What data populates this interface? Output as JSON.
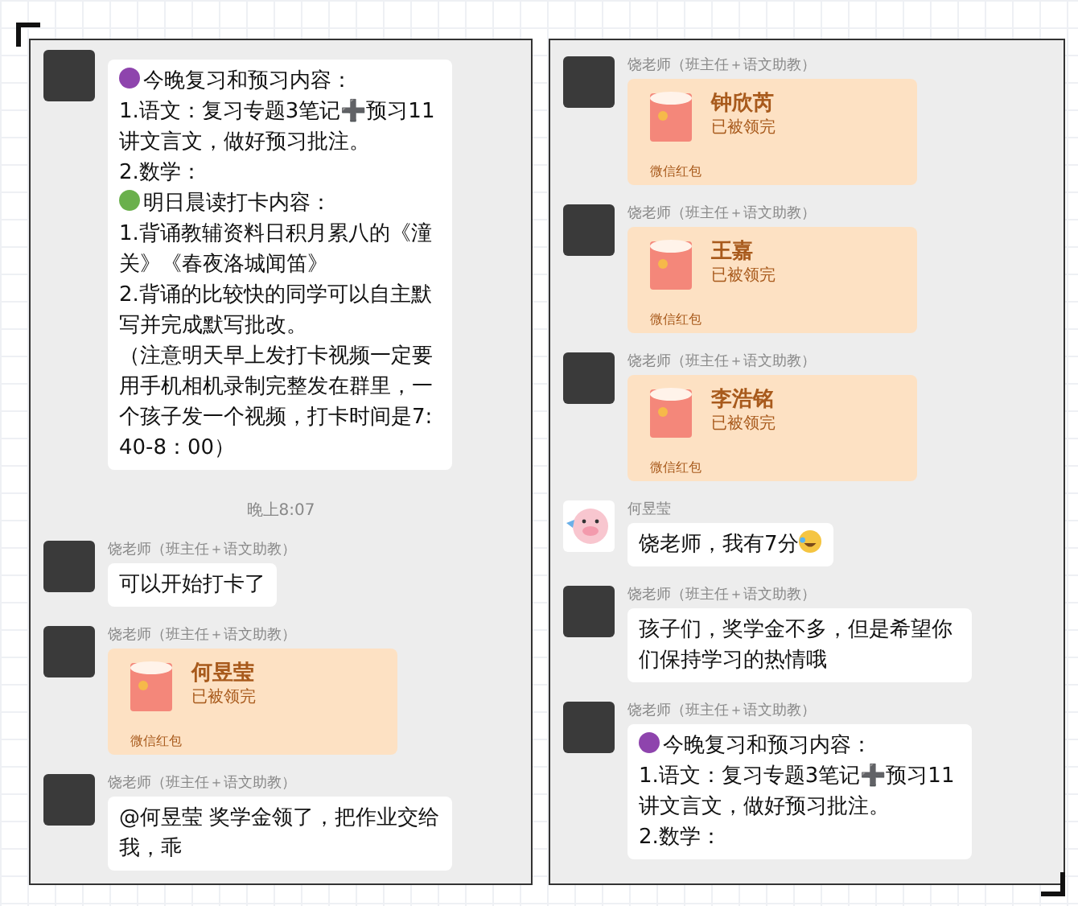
{
  "panels": [
    {
      "messages": [
        {
          "kind": "text",
          "avatar": {
            "kind": "photo"
          },
          "lines": [
            {
              "text": "今晚复习和预习内容：",
              "color": "#8e44ad"
            },
            {
              "text": "1.语文：复习专题3笔记➕预习11讲文言文，做好预习批注。"
            },
            {
              "text": "2.数学："
            },
            {
              "text": "明日晨读打卡内容：",
              "color": "#6ab04c"
            },
            {
              "text": "1.背诵教辅资料日积月累八的《潼关》《春夜洛城闻笛》"
            },
            {
              "text": "2.背诵的比较快的同学可以自主默写并完成默写批改。"
            },
            {
              "text": "（注意明天早上发打卡视频一定要用手机相机录制完整发在群里，一个孩子发一个视频，打卡时间是7:40-8：00）"
            }
          ]
        },
        {
          "kind": "time",
          "text": "晚上8:07"
        },
        {
          "kind": "text",
          "avatar": {
            "kind": "photo"
          },
          "sender": "饶老师（班主任＋语文助教）",
          "lines": [
            {
              "text": "可以开始打卡了"
            }
          ]
        },
        {
          "kind": "red_packet",
          "avatar": {
            "kind": "photo"
          },
          "sender": "饶老师（班主任＋语文助教）",
          "recipient": "何昱莹",
          "status": "已被领完",
          "footer": "微信红包"
        },
        {
          "kind": "text",
          "avatar": {
            "kind": "photo"
          },
          "sender": "饶老师（班主任＋语文助教）",
          "lines": [
            {
              "text": "@何昱莹  奖学金领了，把作业交给我，乖"
            }
          ]
        }
      ]
    },
    {
      "messages": [
        {
          "kind": "red_packet",
          "avatar": {
            "kind": "photo"
          },
          "sender": "饶老师（班主任＋语文助教）",
          "recipient": "钟欣芮",
          "status": "已被领完",
          "footer": "微信红包"
        },
        {
          "kind": "red_packet",
          "avatar": {
            "kind": "photo"
          },
          "sender": "饶老师（班主任＋语文助教）",
          "recipient": "王嘉",
          "status": "已被领完",
          "footer": "微信红包"
        },
        {
          "kind": "red_packet",
          "avatar": {
            "kind": "photo"
          },
          "sender": "饶老师（班主任＋语文助教）",
          "recipient": "李浩铭",
          "status": "已被领完",
          "footer": "微信红包"
        },
        {
          "kind": "text",
          "avatar": {
            "kind": "pig"
          },
          "sender": "何昱莹",
          "lines": [
            {
              "text": "饶老师，我有7分",
              "emoji": true
            }
          ]
        },
        {
          "kind": "text",
          "avatar": {
            "kind": "photo"
          },
          "sender": "饶老师（班主任＋语文助教）",
          "lines": [
            {
              "text": "孩子们，奖学金不多，但是希望你们保持学习的热情哦"
            }
          ]
        },
        {
          "kind": "text",
          "avatar": {
            "kind": "photo"
          },
          "sender": "饶老师（班主任＋语文助教）",
          "lines": [
            {
              "text": "今晚复习和预习内容：",
              "color": "#8e44ad"
            },
            {
              "text": "1.语文：复习专题3笔记➕预习11讲文言文，做好预习批注。"
            },
            {
              "text": "2.数学："
            }
          ]
        }
      ]
    }
  ]
}
